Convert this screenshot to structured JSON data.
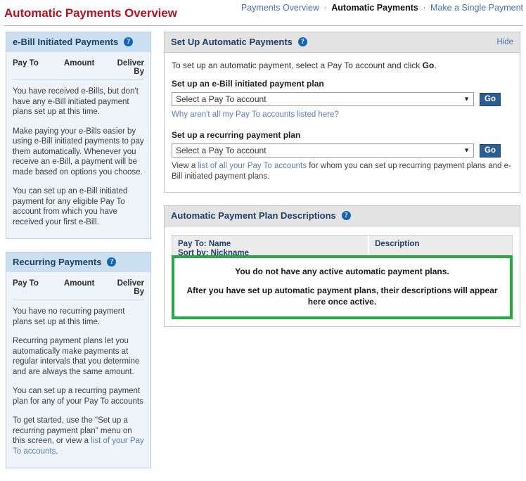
{
  "header": {
    "title": "Automatic Payments Overview",
    "nav": [
      {
        "label": "Payments Overview",
        "current": false
      },
      {
        "label": "Automatic Payments",
        "current": true
      },
      {
        "label": "Make a Single Payment",
        "current": false
      }
    ],
    "separator": "·"
  },
  "icons": {
    "help": "?",
    "dropdown_arrow": "▼"
  },
  "sidebar": {
    "ebill_card": {
      "title": "e-Bill Initiated Payments",
      "columns": {
        "pay_to": "Pay To",
        "amount": "Amount",
        "deliver_by": "Deliver By"
      },
      "paragraphs": [
        "You have received e-Bills, but don't have any e-Bill initiated payment plans set up at this time.",
        "Make paying your e-Bills easier by using e-Bill initiated payments to pay them automatically. Whenever you receive an e-Bill, a payment will be made based on options you choose.",
        "You can set up an e-Bill initiated payment for any eligible Pay To account from which you have received your first e-Bill."
      ]
    },
    "recurring_card": {
      "title": "Recurring Payments",
      "columns": {
        "pay_to": "Pay To",
        "amount": "Amount",
        "deliver_by": "Deliver By"
      },
      "paragraphs": [
        "You have no recurring payment plans set up at this time.",
        "Recurring payment plans let you automatically make payments at regular intervals that you determine and are always the same amount.",
        "You can set up a recurring payment plan for any of your Pay To accounts"
      ],
      "closing_text_before": "To get started, use the \"Set up a recurring payment plan\" menu on this screen, or view a ",
      "closing_link": "list of your Pay To accounts",
      "closing_text_after": "."
    }
  },
  "main": {
    "setup_panel": {
      "title": "Set Up Automatic Payments",
      "hide_label": "Hide",
      "intro_prefix": "To set up an automatic payment, select a Pay To account and click ",
      "intro_bold": "Go",
      "intro_suffix": ".",
      "ebill_plan": {
        "label": "Set up an e-Bill initiated payment plan",
        "select_value": "Select a Pay To account",
        "go_label": "Go",
        "help_link": "Why aren't all my Pay To accounts listed here?"
      },
      "recurring_plan": {
        "label": "Set up a recurring payment plan",
        "select_value": "Select a Pay To account",
        "go_label": "Go",
        "note_prefix": "View a ",
        "note_link": "list of all your Pay To accounts",
        "note_suffix": " for whom you can set up recurring payment plans and e-Bill initiated payment plans."
      }
    },
    "descriptions_panel": {
      "title": "Automatic Payment Plan Descriptions",
      "table": {
        "col_name_line1": "Pay To: Name",
        "col_name_line2": "Sort by: Nickname",
        "col_description": "Description"
      },
      "empty_message_line1": "You do not have any active automatic payment plans.",
      "empty_message_line2": "After you have set up automatic payment plans, their descriptions will appear here once active."
    }
  },
  "colors": {
    "title_red": "#b3121f",
    "link_blue": "#4a6fa8",
    "panel_header_blue": "#1f3f66",
    "go_button": "#2b5c92",
    "empty_box_green": "#27a844",
    "sidebar_bg": "#eef4fa"
  }
}
